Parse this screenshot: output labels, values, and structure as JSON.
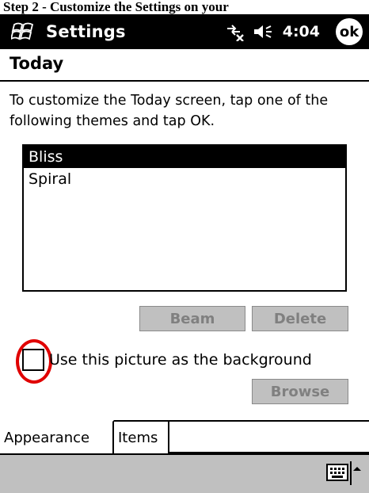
{
  "top_caption": "Step 2 - Customize the Settings on your",
  "titlebar": {
    "app_title": "Settings",
    "clock": "4:04",
    "ok_label": "ok",
    "icons": [
      "windows-start-icon",
      "connectivity-icon",
      "speaker-icon"
    ]
  },
  "page": {
    "title": "Today",
    "instructions": "To customize the Today screen, tap one of the following themes and tap OK."
  },
  "themes": {
    "items": [
      "Bliss",
      "Spiral"
    ],
    "selected": "Bliss"
  },
  "buttons": {
    "beam": "Beam",
    "delete": "Delete",
    "browse": "Browse"
  },
  "background_option": {
    "label": "Use this picture as the background",
    "checked": false
  },
  "tabs": [
    {
      "label": "Appearance",
      "active": true
    },
    {
      "label": "Items",
      "active": false
    }
  ],
  "colors": {
    "titlebar": "#000000",
    "disabled_button": "#c0c0c0",
    "highlight": "#e00000",
    "menubar": "#c0c0c0"
  }
}
